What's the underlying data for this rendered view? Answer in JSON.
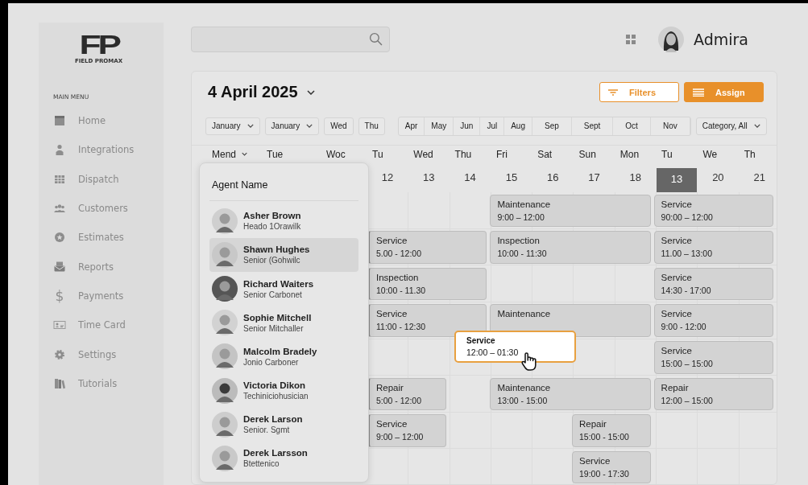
{
  "logo": {
    "mark": "FP",
    "name": "FIELD PROMAX"
  },
  "sidebar": {
    "heading": "MAIN MENU",
    "items": [
      {
        "label": "Home"
      },
      {
        "label": "Integrations"
      },
      {
        "label": "Dispatch"
      },
      {
        "label": "Customers"
      },
      {
        "label": "Estimates"
      },
      {
        "label": "Reports"
      },
      {
        "label": "Payments",
        "glyph": "$"
      },
      {
        "label": "Time Card"
      },
      {
        "label": "Settings"
      },
      {
        "label": "Tutorials"
      }
    ]
  },
  "user": {
    "name": "Admira"
  },
  "calendar": {
    "date": "4 April 2025",
    "buttons": [
      {
        "label": "Filters",
        "kind": "outline"
      },
      {
        "label": "Assign",
        "kind": "filled"
      }
    ],
    "filters": [
      {
        "kind": "dropdown",
        "label": "January"
      },
      {
        "kind": "dropdown",
        "label": "January"
      },
      {
        "kind": "chip",
        "label": "Wed"
      },
      {
        "kind": "chip",
        "label": "Thu"
      },
      {
        "kind": "months",
        "items": [
          "Apr",
          "May",
          "Jun",
          "Jul",
          "Aug",
          "Sep",
          "Sept",
          "Oct",
          "Nov"
        ]
      },
      {
        "kind": "dropdown",
        "label": "Category, All"
      }
    ],
    "days": [
      {
        "name": "Mend",
        "dropdown": true
      },
      {
        "name": "Tue"
      },
      {
        "name": "Woc"
      },
      {
        "name": "Tu",
        "number": "12",
        "selected": false
      },
      {
        "name": "Wed",
        "number": "13",
        "selected": false
      },
      {
        "name": "Thu",
        "number": "14",
        "selected": false
      },
      {
        "name": "Fri",
        "number": "15",
        "selected": false
      },
      {
        "name": "Sat",
        "number": "16",
        "selected": false
      },
      {
        "name": "Sun",
        "number": "17",
        "selected": false
      },
      {
        "name": "Mon",
        "number": "18",
        "selected": false
      },
      {
        "name": "Tu",
        "number": "13",
        "selected": true
      },
      {
        "name": "We",
        "number": "20",
        "selected": false
      },
      {
        "name": "Th",
        "number": "21",
        "selected": false
      }
    ],
    "events": [
      {
        "title": "Maintenance",
        "time": "9:00 – 12:00"
      },
      {
        "title": "Service",
        "time": "90:00 – 12:00"
      },
      {
        "title": "Service",
        "time": "5.00 - 12:00"
      },
      {
        "title": "Inspection",
        "time": "10:00 - 11:30"
      },
      {
        "title": "Service",
        "time": "11.00 – 13:00"
      },
      {
        "title": "Inspection",
        "time": "10:00 - 11.30"
      },
      {
        "title": "Service",
        "time": "14:30 - 17:00"
      },
      {
        "title": "Service",
        "time": "11:00 - 12:30"
      },
      {
        "title": "Maintenance"
      },
      {
        "title": "Service",
        "time": "9:00 - 12:00"
      },
      {
        "title": "Service",
        "time": "15:00 – 15:00"
      },
      {
        "title": "Repair",
        "time": "5:00 - 12:00"
      },
      {
        "title": "Maintenance",
        "time": "13:00 - 15:00"
      },
      {
        "title": "Repair",
        "time": "12:00 – 15:00"
      },
      {
        "title": "Service",
        "time": "9:00 – 12:00"
      },
      {
        "title": "Repair",
        "time": "15:00 - 15:00"
      },
      {
        "title": "Service",
        "time": "19:00 - 17:30"
      }
    ],
    "tooltip": {
      "title": "Service",
      "time": "12:00 – 01:30"
    }
  },
  "agents": {
    "title": "Agent Name",
    "items": [
      {
        "name": "Asher Brown",
        "role": "Heado 1Orawilk",
        "selected": false
      },
      {
        "name": "Shawn Hughes",
        "role": "Senior (Gohwilc",
        "selected": true
      },
      {
        "name": "Richard Waiters",
        "role": "Senior Carbonet",
        "selected": false
      },
      {
        "name": "Sophie Mitchell",
        "role": "Senior Mitchaller",
        "selected": false
      },
      {
        "name": "Malcolm Bradely",
        "role": "Jonio Carboner",
        "selected": false
      },
      {
        "name": "Victoria Dikon",
        "role": "Techiniciohusician",
        "selected": false
      },
      {
        "name": "Derek Larson",
        "role": "Senior. Sgmt",
        "selected": false
      },
      {
        "name": "Derek Larsson",
        "role": "Btettenico",
        "selected": false
      }
    ]
  }
}
